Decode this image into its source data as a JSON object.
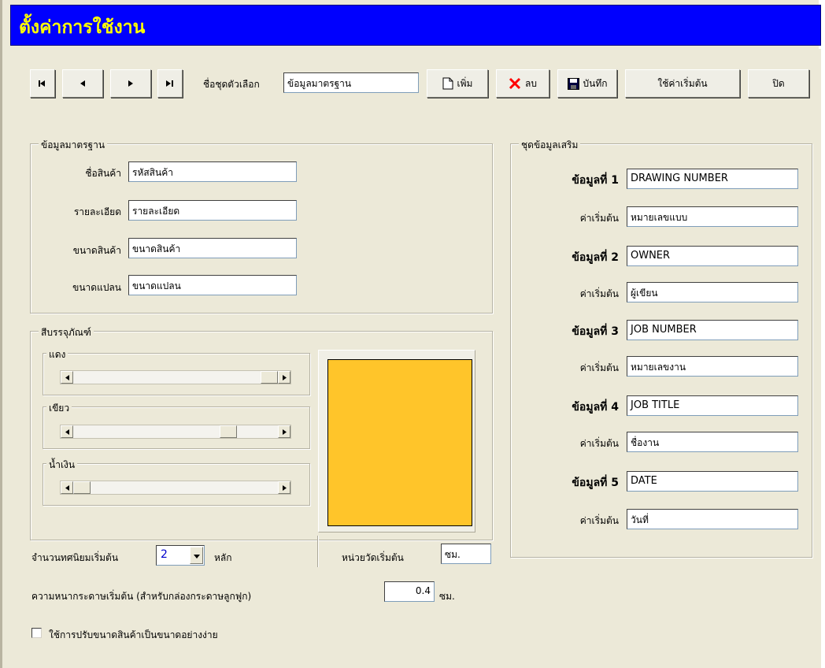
{
  "window": {
    "title": "ตั้งค่าการใช้งาน"
  },
  "toolbar": {
    "nav": [
      "first-icon",
      "prev-icon",
      "next-icon",
      "last-icon"
    ],
    "set_name_label": "ชื่อชุดตัวเลือก",
    "set_name_value": "ข้อมูลมาตรฐาน",
    "add_label": "เพิ่ม",
    "delete_label": "ลบ",
    "save_label": "บันทึก",
    "default_label": "ใช้ค่าเริ่มต้น",
    "close_label": "ปิด",
    "delete_icon_color": "#ff0000"
  },
  "standard": {
    "legend": "ข้อมูลมาตรฐาน",
    "fields": [
      {
        "label": "ชื่อสินค้า",
        "value": "รหัสสินค้า"
      },
      {
        "label": "รายละเอียด",
        "value": "รายละเอียด"
      },
      {
        "label": "ขนาดสินค้า",
        "value": "ขนาดสินค้า"
      },
      {
        "label": "ขนาดแปลน",
        "value": "ขนาดแปลน"
      }
    ]
  },
  "packaging": {
    "legend": "สีบรรจุภัณฑ์",
    "red_label": "แดง",
    "green_label": "เขียว",
    "blue_label": "น้ำเงิน",
    "red_level": 1.0,
    "green_level": 0.78,
    "blue_level": 0.0,
    "color": "#ffc52a"
  },
  "extra": {
    "legend": "ชุดข้อมูลเสริม",
    "default_label": "ค่าเริ่มต้น",
    "items": [
      {
        "label": "ข้อมูลที่ 1",
        "value": "DRAWING NUMBER",
        "default": "หมายเลขแบบ"
      },
      {
        "label": "ข้อมูลที่ 2",
        "value": "OWNER",
        "default": "ผู้เขียน"
      },
      {
        "label": "ข้อมูลที่ 3",
        "value": "JOB NUMBER",
        "default": "หมายเลขงาน"
      },
      {
        "label": "ข้อมูลที่ 4",
        "value": "JOB TITLE",
        "default": "ชื่องาน"
      },
      {
        "label": "ข้อมูลที่ 5",
        "value": "DATE",
        "default": "วันที่"
      }
    ]
  },
  "bottom": {
    "decimals_label": "จำนวนทศนิยมเริ่มต้น",
    "decimals_value": "2",
    "decimals_unit": "หลัก",
    "unit_label": "หน่วยวัดเริ่มต้น",
    "unit_value": "ซม.",
    "thickness_label": "ความหนากระดาษเริ่มต้น (สำหรับกล่องกระดาษลูกฟูก)",
    "thickness_value": "0.4",
    "thickness_unit": "ซม.",
    "checkbox_label": "ใช้การปรับขนาดสินค้าเป็นขนาดอย่างง่าย",
    "checkbox_checked": false
  }
}
